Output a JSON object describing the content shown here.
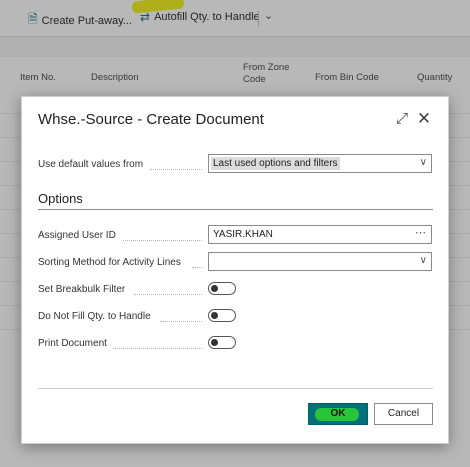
{
  "toolbar": {
    "create_putaway": "Create Put-away...",
    "autofill": "Autofill Qty. to Handle"
  },
  "grid": {
    "headers": [
      "Item No.",
      "Description",
      "From Zone Code",
      "From Bin Code",
      "Quantity"
    ]
  },
  "dialog": {
    "title": "Whse.-Source - Create Document",
    "use_default_label": "Use default values from",
    "use_default_value": "Last used options and filters",
    "section_title": "Options",
    "fields": {
      "assigned_user_label": "Assigned User ID",
      "assigned_user_value": "YASIR.KHAN",
      "sorting_label": "Sorting Method for Activity Lines",
      "sorting_value": "",
      "breakbulk_label": "Set Breakbulk Filter",
      "breakbulk_on": false,
      "donotfill_label": "Do Not Fill Qty. to Handle",
      "donotfill_on": false,
      "print_label": "Print Document",
      "print_on": false
    },
    "ok_label": "OK",
    "cancel_label": "Cancel"
  },
  "colors": {
    "accent": "#00707a",
    "highlight_yellow": "#f2f218",
    "highlight_green": "#2fd22f"
  },
  "icons": {
    "putaway": "document-icon",
    "autofill": "autofill-icon",
    "expand": "expand-icon",
    "close": "close-icon",
    "more": "ellipsis-icon",
    "dropdown": "chevron-down-icon"
  }
}
